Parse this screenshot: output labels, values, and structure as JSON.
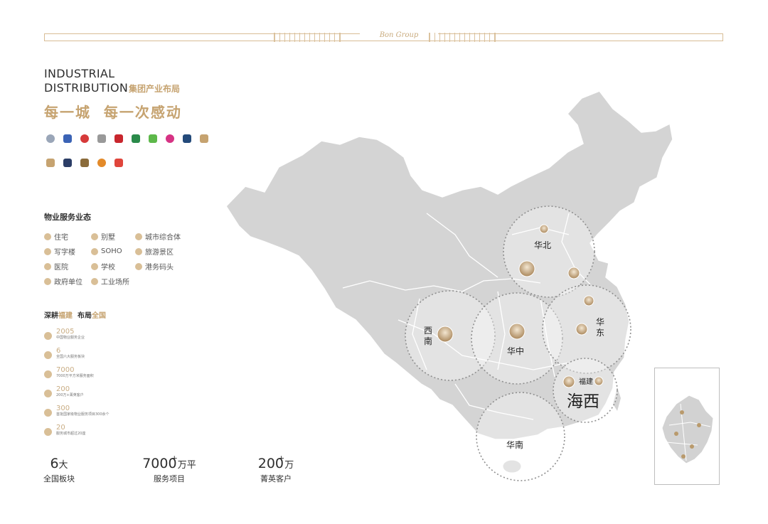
{
  "header": {
    "brand": "Bon Group"
  },
  "title": {
    "en_line1": "INDUSTRIAL",
    "en_line2": "DISTRIBUTION",
    "cn": "集团产业布局",
    "slogan": "每一城  每一次感动"
  },
  "services": {
    "title": "物业服务业态",
    "items": [
      "住宅",
      "别墅",
      "城市综合体",
      "写字楼",
      "SOHO",
      "旅游景区",
      "医院",
      "学校",
      "港务码头",
      "政府单位",
      "工业场所"
    ]
  },
  "deep": {
    "a": "深耕",
    "b": "福建",
    "c": "布局",
    "d": "全国"
  },
  "stats_list": [
    {
      "num": "2005",
      "desc": "中国物业服务企业"
    },
    {
      "num": "6",
      "desc": "全国六大服务板块"
    },
    {
      "num": "7000",
      "desc": "7000万平方米服务面积"
    },
    {
      "num": "200",
      "desc": "200万+菁英客户"
    },
    {
      "num": "300",
      "desc": "首批国家级物业服务项目300余个"
    },
    {
      "num": "20",
      "desc": "服务城市超过20座"
    }
  ],
  "big_stats": [
    {
      "value": "6",
      "unit": "大",
      "plus": "",
      "label": "全国板块"
    },
    {
      "value": "7000",
      "unit": "万平",
      "plus": "+",
      "label": "服务项目"
    },
    {
      "value": "200",
      "unit": "万",
      "plus": "+",
      "label": "菁英客户"
    }
  ],
  "regions": {
    "huabei": "华北",
    "xinan1": "西",
    "xinan2": "南",
    "huazhong": "华中",
    "huadong1": "华",
    "huadong2": "东",
    "haixi": "海西",
    "fujian": "福建",
    "huanan": "华南"
  },
  "colors": {
    "gold": "#c6a370",
    "map_fill": "#d4d4d4",
    "map_stroke": "#ffffff"
  }
}
